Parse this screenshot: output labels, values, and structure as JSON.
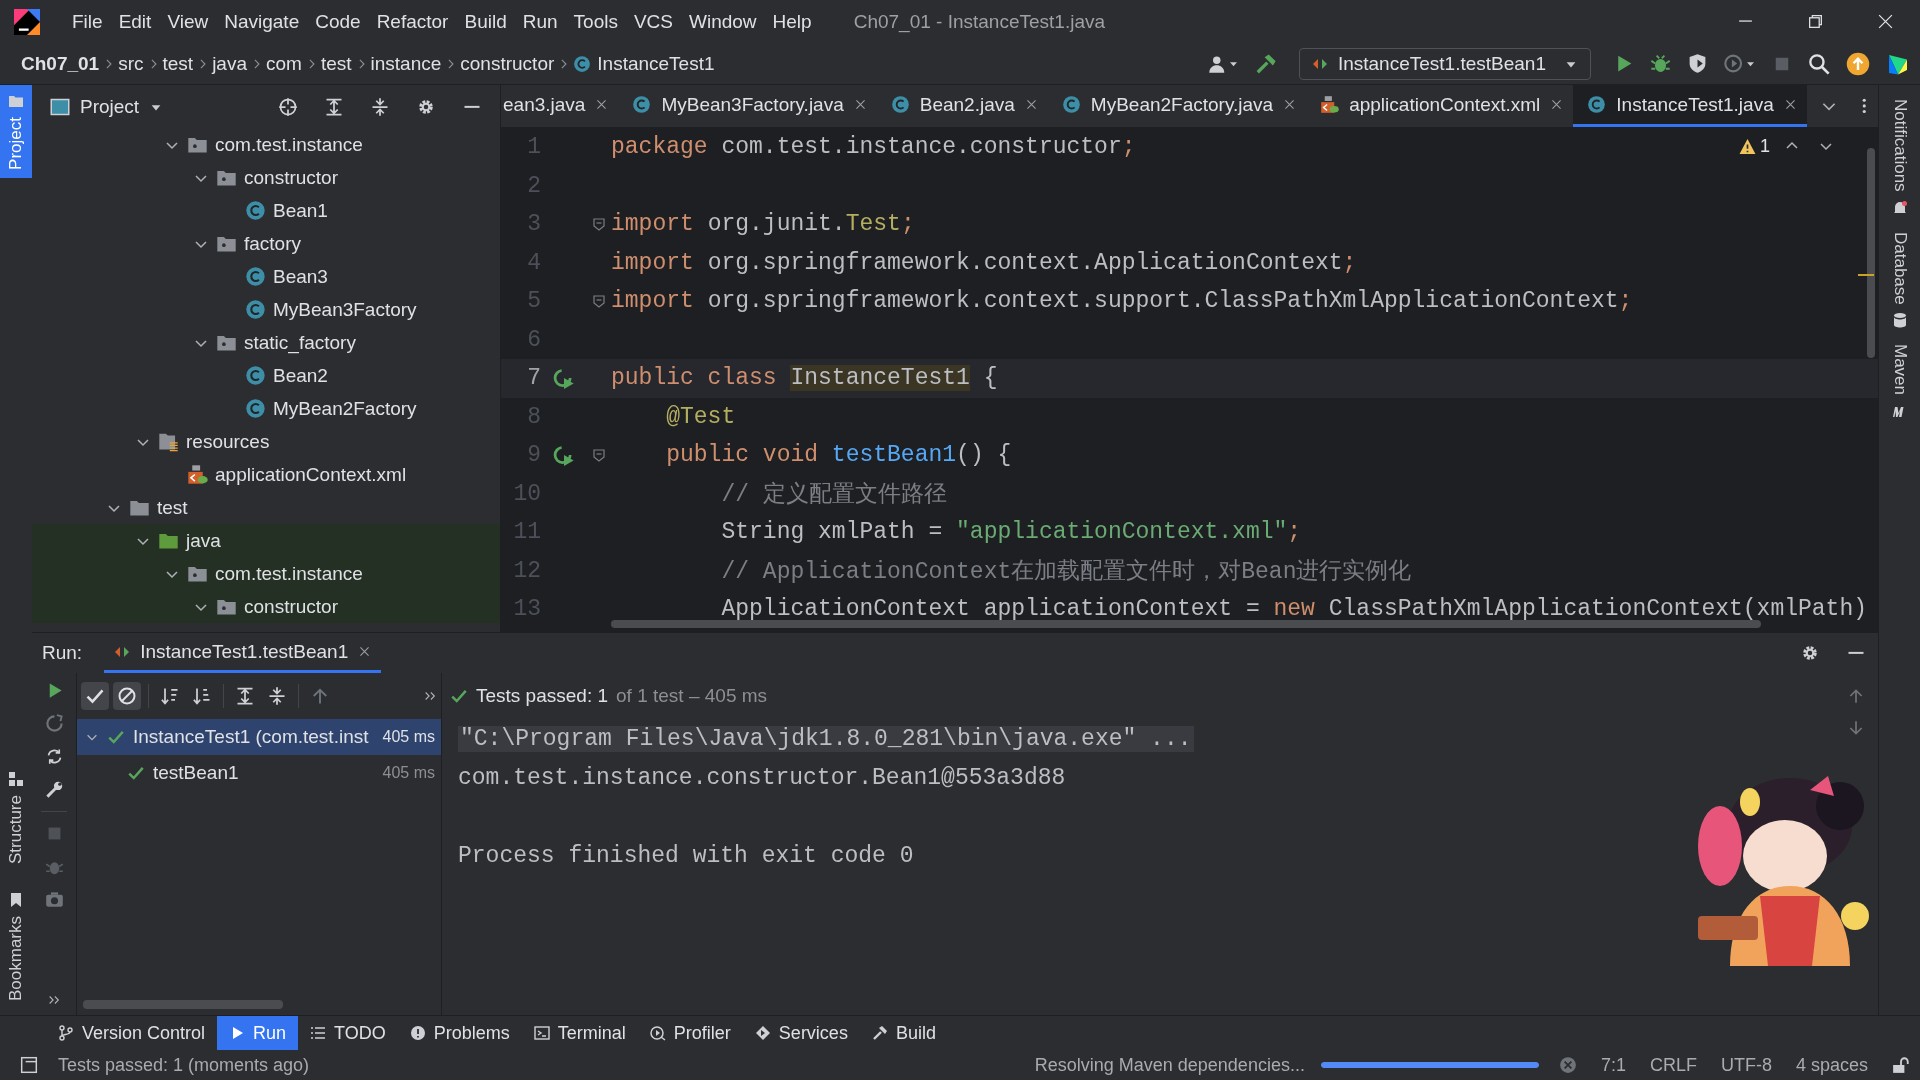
{
  "menu": [
    "File",
    "Edit",
    "View",
    "Navigate",
    "Code",
    "Refactor",
    "Build",
    "Run",
    "Tools",
    "VCS",
    "Window",
    "Help"
  ],
  "window_title": "Ch07_01 - InstanceTest1.java",
  "breadcrumbs": [
    "Ch07_01",
    "src",
    "test",
    "java",
    "com",
    "test",
    "instance",
    "constructor",
    "InstanceTest1"
  ],
  "run_config": "InstanceTest1.testBean1",
  "left_strip": [
    {
      "label": "Project",
      "selected": true
    },
    {
      "label": "Structure",
      "selected": false
    },
    {
      "label": "Bookmarks",
      "selected": false
    }
  ],
  "right_strip": [
    "Notifications",
    "Database",
    "Maven"
  ],
  "project_panel": {
    "title": "Project",
    "tree": [
      {
        "children": [
          {
            "children": [
              {
                "label": "com.test.instance",
                "kind": "package",
                "expanded": true,
                "children": [
                  {
                    "label": "constructor",
                    "kind": "package",
                    "expanded": true,
                    "children": [
                      {
                        "label": "Bean1",
                        "kind": "class"
                      }
                    ]
                  },
                  {
                    "label": "factory",
                    "kind": "package",
                    "expanded": true,
                    "children": [
                      {
                        "label": "Bean3",
                        "kind": "class"
                      },
                      {
                        "label": "MyBean3Factory",
                        "kind": "class"
                      }
                    ]
                  },
                  {
                    "label": "static_factory",
                    "kind": "package",
                    "expanded": true,
                    "children": [
                      {
                        "label": "Bean2",
                        "kind": "class"
                      },
                      {
                        "label": "MyBean2Factory",
                        "kind": "class"
                      }
                    ]
                  }
                ]
              }
            ]
          },
          {
            "label": "resources",
            "kind": "resources",
            "expanded": true,
            "children": [
              {
                "label": "applicationContext.xml",
                "kind": "xml"
              }
            ]
          }
        ]
      },
      {
        "label": "test",
        "kind": "folder",
        "expanded": true,
        "children": [
          {
            "label": "java",
            "kind": "test-root",
            "expanded": true,
            "children": [
              {
                "label": "com.test.instance",
                "kind": "package",
                "expanded": true,
                "children": [
                  {
                    "label": "constructor",
                    "kind": "package",
                    "expanded": true
                  }
                ]
              }
            ]
          }
        ]
      }
    ]
  },
  "editor_tabs": [
    {
      "label": "ean3.java",
      "selected": false
    },
    {
      "label": "MyBean3Factory.java",
      "kind": "class",
      "selected": false
    },
    {
      "label": "Bean2.java",
      "kind": "class",
      "selected": false
    },
    {
      "label": "MyBean2Factory.java",
      "kind": "class",
      "selected": false
    },
    {
      "label": "applicationContext.xml",
      "kind": "xml",
      "selected": false
    },
    {
      "label": "InstanceTest1.java",
      "kind": "class",
      "selected": true
    }
  ],
  "warning_count": "1",
  "code_lines": [
    {
      "number": "1",
      "current": false,
      "tokens": [
        {
          "kind": "keyword",
          "text": "package"
        },
        {
          "kind": "plain",
          "text": " com.test.instance.constructor"
        },
        {
          "kind": "keyword",
          "text": ";"
        }
      ]
    },
    {
      "number": "2",
      "current": false
    },
    {
      "number": "3",
      "current": false,
      "fold": true,
      "tokens": [
        {
          "kind": "keyword",
          "text": "import"
        },
        {
          "kind": "plain",
          "text": " org.junit."
        },
        {
          "kind": "annotation",
          "text": "Test"
        },
        {
          "kind": "keyword",
          "text": ";"
        }
      ]
    },
    {
      "number": "4",
      "current": false,
      "tokens": [
        {
          "kind": "keyword",
          "text": "import"
        },
        {
          "kind": "plain",
          "text": " org.springframework.context.ApplicationContext"
        },
        {
          "kind": "keyword",
          "text": ";"
        }
      ]
    },
    {
      "number": "5",
      "current": false,
      "fold": true,
      "tokens": [
        {
          "kind": "keyword",
          "text": "import"
        },
        {
          "kind": "plain",
          "text": " org.springframework.context.support.ClassPathXmlApplicationContext"
        },
        {
          "kind": "keyword",
          "text": ";"
        }
      ]
    },
    {
      "number": "6",
      "current": false
    },
    {
      "number": "7",
      "current": true,
      "run": true,
      "tokens": [
        {
          "kind": "keyword",
          "text": "public class "
        },
        {
          "kind": "highlight",
          "text": "InstanceTest1"
        },
        {
          "kind": "plain",
          "text": " {"
        }
      ]
    },
    {
      "number": "8",
      "current": false,
      "tokens": [
        {
          "kind": "annotation",
          "text": "    @Test"
        }
      ]
    },
    {
      "number": "9",
      "current": false,
      "run": true,
      "fold": true,
      "tokens": [
        {
          "kind": "keyword",
          "text": "    public void "
        },
        {
          "kind": "method",
          "text": "testBean1"
        },
        {
          "kind": "plain",
          "text": "() {"
        }
      ]
    },
    {
      "number": "10",
      "current": false,
      "tokens": [
        {
          "kind": "comment",
          "text": "        // 定义配置文件路径"
        }
      ]
    },
    {
      "number": "11",
      "current": false,
      "tokens": [
        {
          "kind": "plain",
          "text": "        String xmlPath = "
        },
        {
          "kind": "string",
          "text": "\"applicationContext.xml\""
        },
        {
          "kind": "keyword",
          "text": ";"
        }
      ]
    },
    {
      "number": "12",
      "current": false,
      "tokens": [
        {
          "kind": "comment",
          "text": "        // ApplicationContext在加载配置文件时，对Bean进行实例化"
        }
      ]
    },
    {
      "number": "13",
      "current": false,
      "tokens": [
        {
          "kind": "plain",
          "text": "        ApplicationContext applicationContext = "
        },
        {
          "kind": "keyword",
          "text": "new"
        },
        {
          "kind": "plain",
          "text": " ClassPathXmlApplicationContext(xmlPath)"
        }
      ]
    }
  ],
  "run_panel": {
    "label": "Run:",
    "tab": "InstanceTest1.testBean1",
    "toggles": [
      {
        "kind": "show-passed",
        "on": true
      },
      {
        "kind": "show-ignored",
        "on": true
      }
    ],
    "summary": "Tests passed: 1",
    "summary_detail": "of 1 test – 405 ms",
    "tests": [
      {
        "name": "InstanceTest1 (com.test.inst",
        "time": "405 ms",
        "selected": true,
        "children": [
          {
            "name": "testBean1",
            "time": "405 ms",
            "selected": false
          }
        ]
      }
    ],
    "console": [
      {
        "kind": "folded",
        "text": "\"C:\\Program Files\\Java\\jdk1.8.0_281\\bin\\java.exe\" ..."
      },
      {
        "kind": "output",
        "text": "com.test.instance.constructor.Bean1@553a3d88"
      },
      {
        "kind": "blank"
      },
      {
        "kind": "output",
        "text": "Process finished with exit code 0"
      }
    ]
  },
  "tool_tabs": [
    {
      "label": "Version Control",
      "kind": "vcs",
      "selected": false
    },
    {
      "label": "Run",
      "kind": "run",
      "selected": true
    },
    {
      "label": "TODO",
      "kind": "todo",
      "selected": false
    },
    {
      "label": "Problems",
      "kind": "problems",
      "selected": false
    },
    {
      "label": "Terminal",
      "kind": "terminal",
      "selected": false
    },
    {
      "label": "Profiler",
      "kind": "profiler",
      "selected": false
    },
    {
      "label": "Services",
      "kind": "services",
      "selected": false
    },
    {
      "label": "Build",
      "kind": "build",
      "selected": false
    }
  ],
  "status_bar": {
    "message": "Tests passed: 1 (moments ago)",
    "task": "Resolving Maven dependencies...",
    "level": 1,
    "position": "7:1",
    "line_separator": "CRLF",
    "encoding": "UTF-8",
    "indent": "4 spaces"
  }
}
